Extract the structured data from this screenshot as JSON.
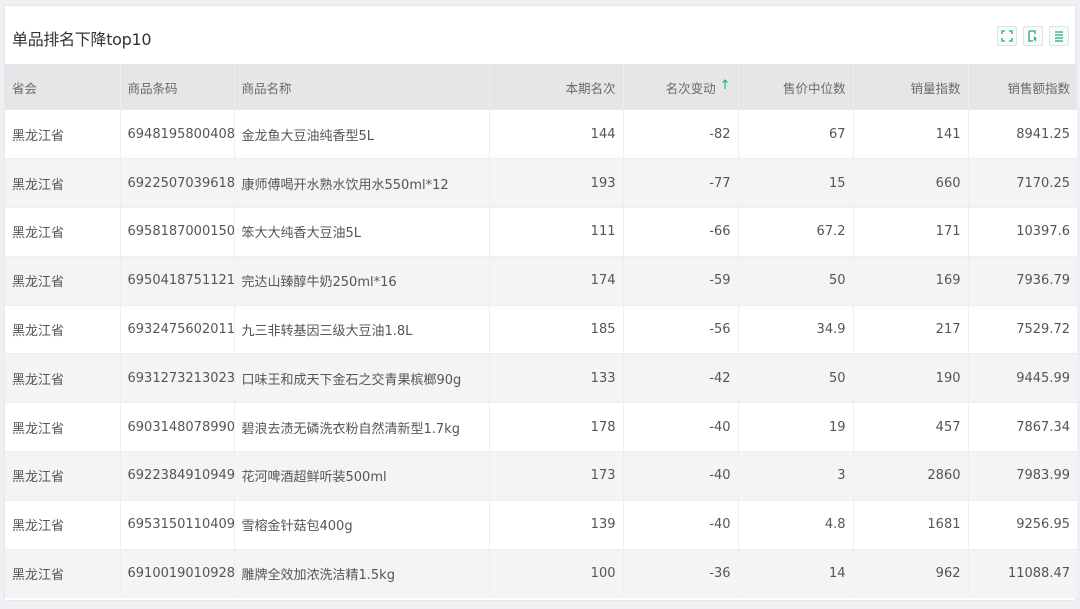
{
  "panel": {
    "title": "单品排名下降top10",
    "tools": [
      "fullscreen-icon",
      "export-icon",
      "menu-icon"
    ]
  },
  "colors": {
    "accent": "#17b26a",
    "header_bg": "#e5e6e8",
    "stripe": "#f4f4f5"
  },
  "table": {
    "columns": {
      "province": "省会",
      "barcode": "商品条码",
      "name": "商品名称",
      "rank": "本期名次",
      "change": "名次变动",
      "median_price": "售价中位数",
      "volume_index": "销量指数",
      "sales_index": "销售额指数"
    },
    "sort_indicator": "↑",
    "rows": [
      {
        "province": "黑龙江省",
        "barcode": "6948195800408",
        "name": "金龙鱼大豆油纯香型5L",
        "rank": "144",
        "change": "-82",
        "median_price": "67",
        "volume_index": "141",
        "sales_index": "8941.25"
      },
      {
        "province": "黑龙江省",
        "barcode": "6922507039618",
        "name": "康师傅喝开水熟水饮用水550ml*12",
        "rank": "193",
        "change": "-77",
        "median_price": "15",
        "volume_index": "660",
        "sales_index": "7170.25"
      },
      {
        "province": "黑龙江省",
        "barcode": "6958187000150",
        "name": "笨大大纯香大豆油5L",
        "rank": "111",
        "change": "-66",
        "median_price": "67.2",
        "volume_index": "171",
        "sales_index": "10397.6"
      },
      {
        "province": "黑龙江省",
        "barcode": "6950418751121",
        "name": "完达山臻醇牛奶250ml*16",
        "rank": "174",
        "change": "-59",
        "median_price": "50",
        "volume_index": "169",
        "sales_index": "7936.79"
      },
      {
        "province": "黑龙江省",
        "barcode": "6932475602011",
        "name": "九三非转基因三级大豆油1.8L",
        "rank": "185",
        "change": "-56",
        "median_price": "34.9",
        "volume_index": "217",
        "sales_index": "7529.72"
      },
      {
        "province": "黑龙江省",
        "barcode": "6931273213023",
        "name": "口味王和成天下金石之交青果槟榔90g",
        "rank": "133",
        "change": "-42",
        "median_price": "50",
        "volume_index": "190",
        "sales_index": "9445.99"
      },
      {
        "province": "黑龙江省",
        "barcode": "6903148078990",
        "name": "碧浪去渍无磷洗衣粉自然清新型1.7kg",
        "rank": "178",
        "change": "-40",
        "median_price": "19",
        "volume_index": "457",
        "sales_index": "7867.34"
      },
      {
        "province": "黑龙江省",
        "barcode": "6922384910949",
        "name": "花河啤酒超鲜听装500ml",
        "rank": "173",
        "change": "-40",
        "median_price": "3",
        "volume_index": "2860",
        "sales_index": "7983.99"
      },
      {
        "province": "黑龙江省",
        "barcode": "6953150110409",
        "name": "雪榕金针菇包400g",
        "rank": "139",
        "change": "-40",
        "median_price": "4.8",
        "volume_index": "1681",
        "sales_index": "9256.95"
      },
      {
        "province": "黑龙江省",
        "barcode": "6910019010928",
        "name": "雕牌全效加浓洗洁精1.5kg",
        "rank": "100",
        "change": "-36",
        "median_price": "14",
        "volume_index": "962",
        "sales_index": "11088.47"
      }
    ]
  }
}
